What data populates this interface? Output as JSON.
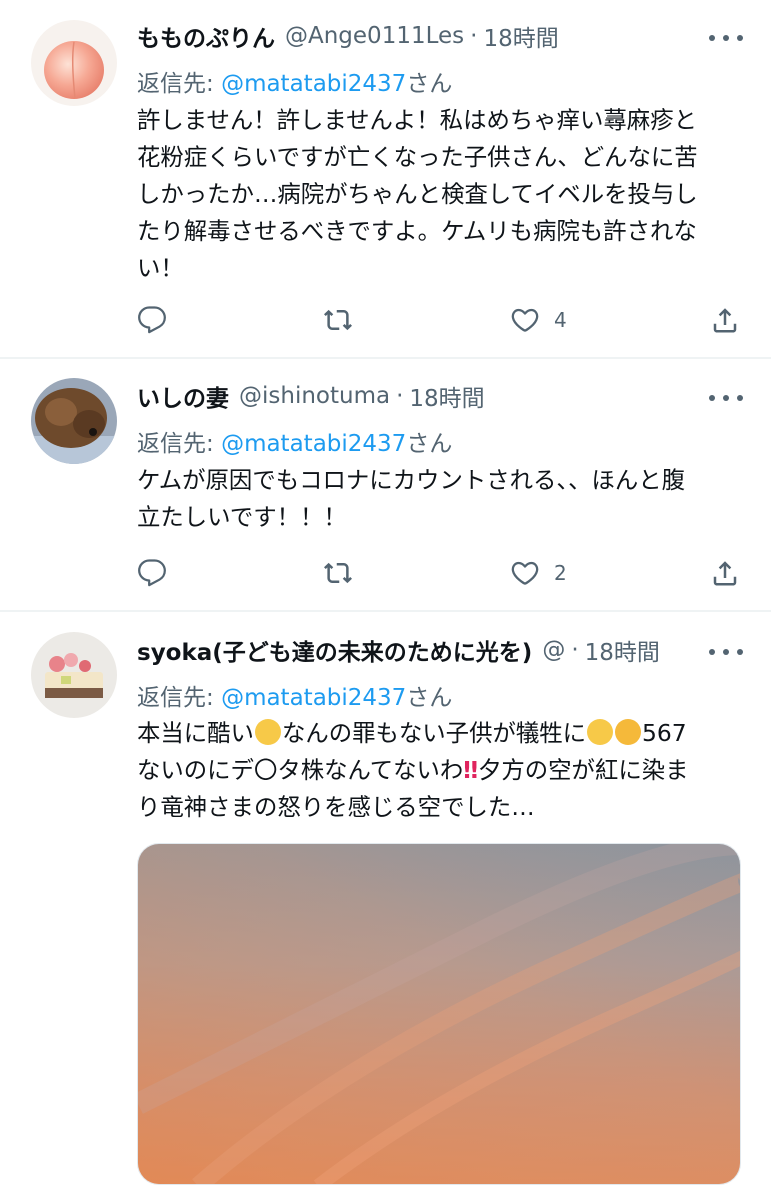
{
  "tweets": [
    {
      "name": "もものぷりん",
      "handle": "@Ange0111Les",
      "time": "18時間",
      "reply_prefix": "返信先: ",
      "reply_to": "@matatabi2437",
      "reply_suffix": "さん",
      "lines": [
        "許しません！許しませんよ！私はめちゃ痒い蕁麻疹と",
        "花粉症くらいですが亡くなった子供さん、どんなに苦",
        "しかったか…病院がちゃんと検査してイベルを投与し",
        "たり解毒させるべきですよ。ケムリも病院も許されな",
        "い！"
      ],
      "like_count": "4"
    },
    {
      "name": "いしの妻",
      "handle": "@ishinotuma",
      "time": "18時間",
      "reply_prefix": "返信先: ",
      "reply_to": "@matatabi2437",
      "reply_suffix": "さん",
      "lines": [
        "ケムが原因でもコロナにカウントされる、、ほんと腹",
        "立たしいです！！！"
      ],
      "like_count": "2"
    },
    {
      "name": "syoka(子ども達の未来のために光を)",
      "handle": "@",
      "time": "18時間",
      "reply_prefix": "返信先: ",
      "reply_to": "@matatabi2437",
      "reply_suffix": "さん",
      "line1_a": "本当に酷い",
      "line1_b": "なんの罪もない子供が犠牲に",
      "line1_c": "567",
      "line2_a": "ないのにデ〇タ株なんてないわ",
      "line2_bang": "‼",
      "line2_b": "夕方の空が紅に染ま",
      "line3": "り竜神さまの怒りを感じる空でした…"
    }
  ],
  "icons": {
    "reply": "reply-icon",
    "retweet": "retweet-icon",
    "like": "heart-icon",
    "share": "share-icon",
    "more": "more-icon",
    "emoji_cry": "loudly-crying-face-emoji",
    "emoji_angry": "angry-face-emoji"
  },
  "colors": {
    "accent": "#1d9bf0",
    "secondary_text": "#536471",
    "divider": "#eff3f4"
  }
}
